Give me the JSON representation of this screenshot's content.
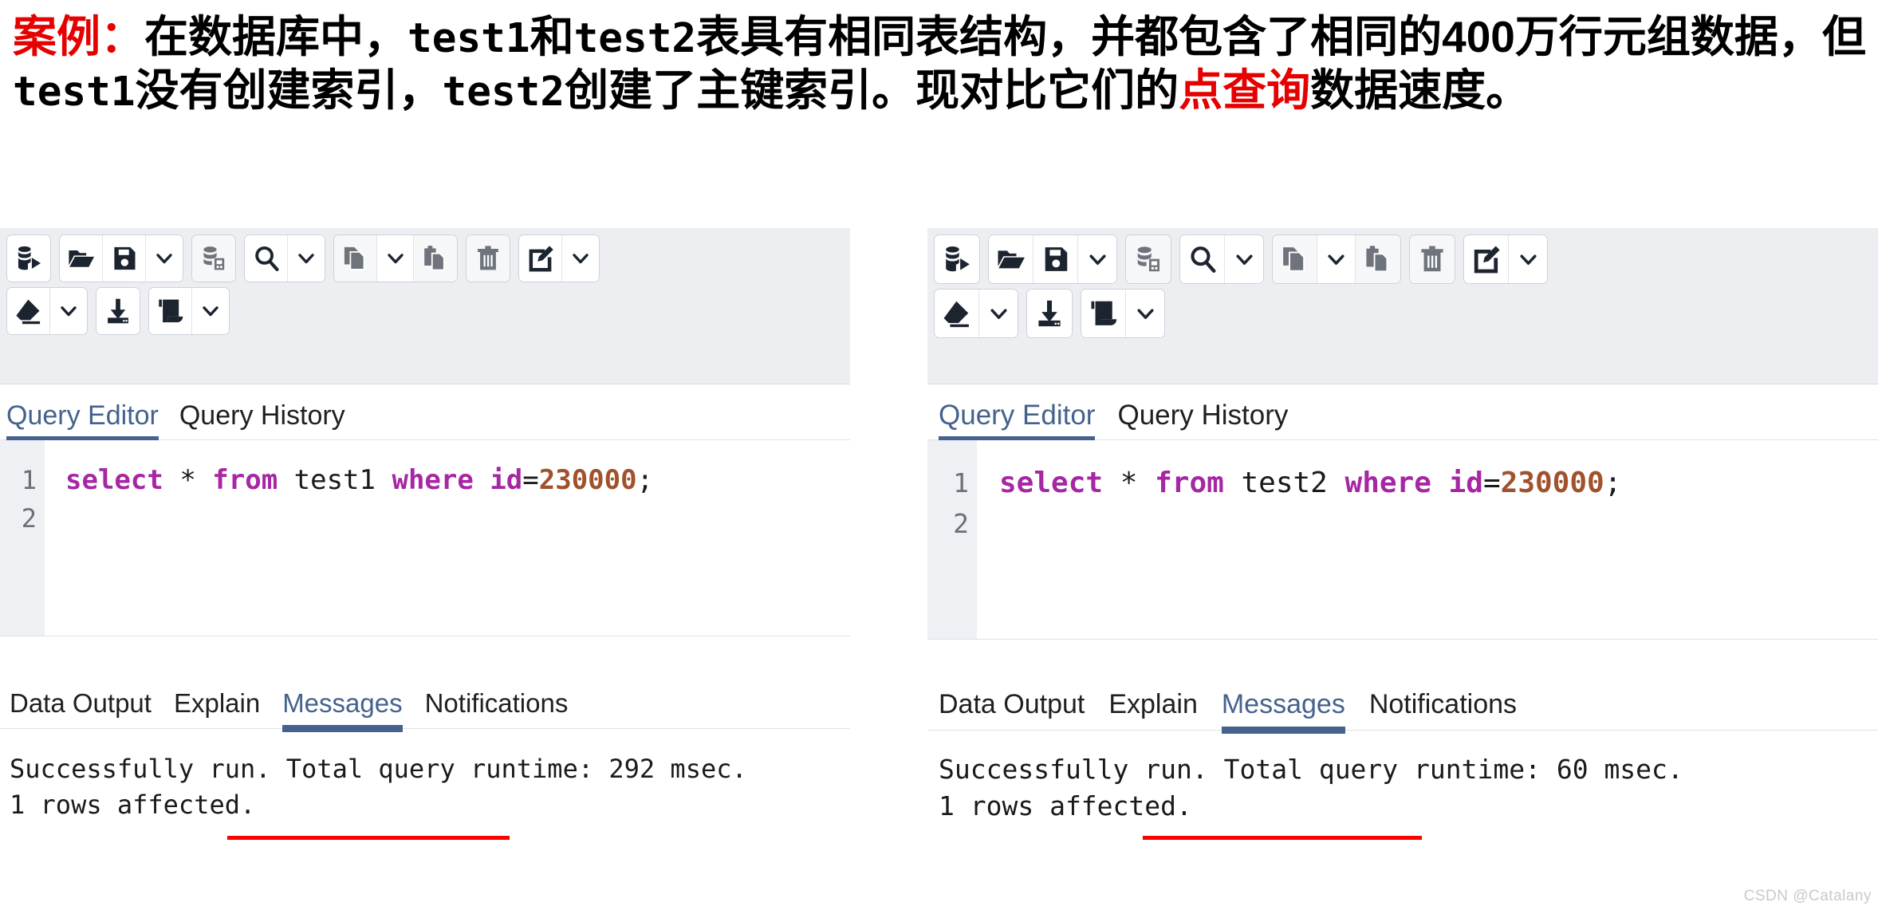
{
  "caption": {
    "label_red": "案例：",
    "seg1": "在数据库中，",
    "mono1": "test1",
    "seg2": "和",
    "mono2": "test2",
    "seg3": "表具有相同表结构，并都包含了相同的400万行元组数据，但",
    "mono3": "test1",
    "seg4": "没有创建索引，",
    "mono4": "test2",
    "seg5": "创建了主键索引。现对比它们的",
    "hl_red": "点查询",
    "seg6": "数据速度。",
    "accent_color": "#e60000"
  },
  "toolbar": {
    "groups": [
      {
        "buttons": [
          {
            "icon": "execute-query-icon",
            "title": "Execute/Refresh"
          }
        ]
      },
      {
        "buttons": [
          {
            "icon": "open-file-icon",
            "title": "Open File"
          },
          {
            "icon": "save-file-icon",
            "title": "Save File"
          },
          {
            "icon": "chevron-down-icon",
            "title": "Save options"
          }
        ]
      },
      {
        "buttons": [
          {
            "icon": "filter-data-icon",
            "title": "Filter / Sort",
            "dim": true
          }
        ]
      },
      {
        "buttons": [
          {
            "icon": "search-icon",
            "title": "Find"
          },
          {
            "icon": "chevron-down-icon",
            "title": "Find options"
          }
        ]
      },
      {
        "buttons": [
          {
            "icon": "copy-icon",
            "title": "Copy",
            "dim": true
          },
          {
            "icon": "chevron-down-icon",
            "title": "Copy options"
          },
          {
            "icon": "paste-icon",
            "title": "Paste",
            "dim": true
          }
        ]
      },
      {
        "buttons": [
          {
            "icon": "trash-icon",
            "title": "Delete",
            "dim": true
          }
        ]
      },
      {
        "buttons": [
          {
            "icon": "edit-pencil-icon",
            "title": "Edit"
          },
          {
            "icon": "chevron-down-icon",
            "title": "Edit options"
          }
        ]
      }
    ],
    "groups_row2": [
      {
        "buttons": [
          {
            "icon": "eraser-icon",
            "title": "Clear"
          },
          {
            "icon": "chevron-down-icon",
            "title": "Clear options"
          }
        ]
      },
      {
        "buttons": [
          {
            "icon": "download-icon",
            "title": "Download as CSV"
          }
        ]
      },
      {
        "buttons": [
          {
            "icon": "macro-scroll-icon",
            "title": "Macros"
          },
          {
            "icon": "chevron-down-icon",
            "title": "Macro options"
          }
        ]
      }
    ]
  },
  "panels": [
    {
      "id": "left",
      "tabs": [
        {
          "label": "Query Editor",
          "active": true
        },
        {
          "label": "Query History",
          "active": false
        }
      ],
      "editor": {
        "line_numbers": [
          "1",
          "2"
        ],
        "sql_tokens": [
          {
            "t": "select",
            "c": "kw"
          },
          {
            "t": " ",
            "c": "op"
          },
          {
            "t": "*",
            "c": "op"
          },
          {
            "t": " ",
            "c": "op"
          },
          {
            "t": "from",
            "c": "kw"
          },
          {
            "t": " test1 ",
            "c": "op"
          },
          {
            "t": "where",
            "c": "kw"
          },
          {
            "t": " ",
            "c": "op"
          },
          {
            "t": "id",
            "c": "kw"
          },
          {
            "t": "=",
            "c": "op"
          },
          {
            "t": "230000",
            "c": "num"
          },
          {
            "t": ";",
            "c": "op"
          }
        ]
      },
      "output_tabs": [
        {
          "label": "Data Output",
          "active": false
        },
        {
          "label": "Explain",
          "active": false
        },
        {
          "label": "Messages",
          "active": true
        },
        {
          "label": "Notifications",
          "active": false
        }
      ],
      "messages": [
        "Successfully run. Total query runtime: 292 msec.",
        "1 rows affected."
      ],
      "runtime_value": "292 msec."
    },
    {
      "id": "right",
      "tabs": [
        {
          "label": "Query Editor",
          "active": true
        },
        {
          "label": "Query History",
          "active": false
        }
      ],
      "editor": {
        "line_numbers": [
          "1",
          "2"
        ],
        "sql_tokens": [
          {
            "t": "select",
            "c": "kw"
          },
          {
            "t": " ",
            "c": "op"
          },
          {
            "t": "*",
            "c": "op"
          },
          {
            "t": " ",
            "c": "op"
          },
          {
            "t": "from",
            "c": "kw"
          },
          {
            "t": " test2 ",
            "c": "op"
          },
          {
            "t": "where",
            "c": "kw"
          },
          {
            "t": " ",
            "c": "op"
          },
          {
            "t": "id",
            "c": "kw"
          },
          {
            "t": "=",
            "c": "op"
          },
          {
            "t": "230000",
            "c": "num"
          },
          {
            "t": ";",
            "c": "op"
          }
        ]
      },
      "output_tabs": [
        {
          "label": "Data Output",
          "active": false
        },
        {
          "label": "Explain",
          "active": false
        },
        {
          "label": "Messages",
          "active": true
        },
        {
          "label": "Notifications",
          "active": false
        }
      ],
      "messages": [
        "Successfully run. Total query runtime: 60 msec.",
        "1 rows affected."
      ],
      "runtime_value": "60 msec."
    }
  ],
  "watermark": "CSDN @Catalany",
  "colors": {
    "tab_active": "#44628d",
    "underline_red": "#fe0000",
    "keyword_purple": "#a626a4",
    "number_brown": "#a0522d",
    "toolbar_bg": "#eceef2"
  }
}
